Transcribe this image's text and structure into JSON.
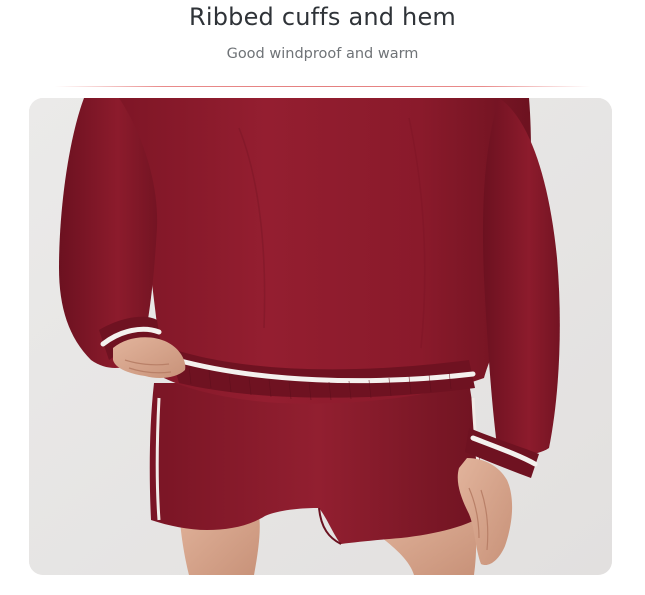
{
  "section": {
    "title": "Ribbed cuffs and hem",
    "subtitle": "Good windproof and warm"
  },
  "photo": {
    "alt": "Model wearing burgundy sweatshirt with white-striped ribbed cuffs and hem, and matching burgundy shorts",
    "colors": {
      "background": "#e9e8e7",
      "garment": "#8c1b2b",
      "garment_shadow": "#6e1220",
      "trim": "#f4f1ee",
      "skin": "#d9a88f"
    }
  }
}
